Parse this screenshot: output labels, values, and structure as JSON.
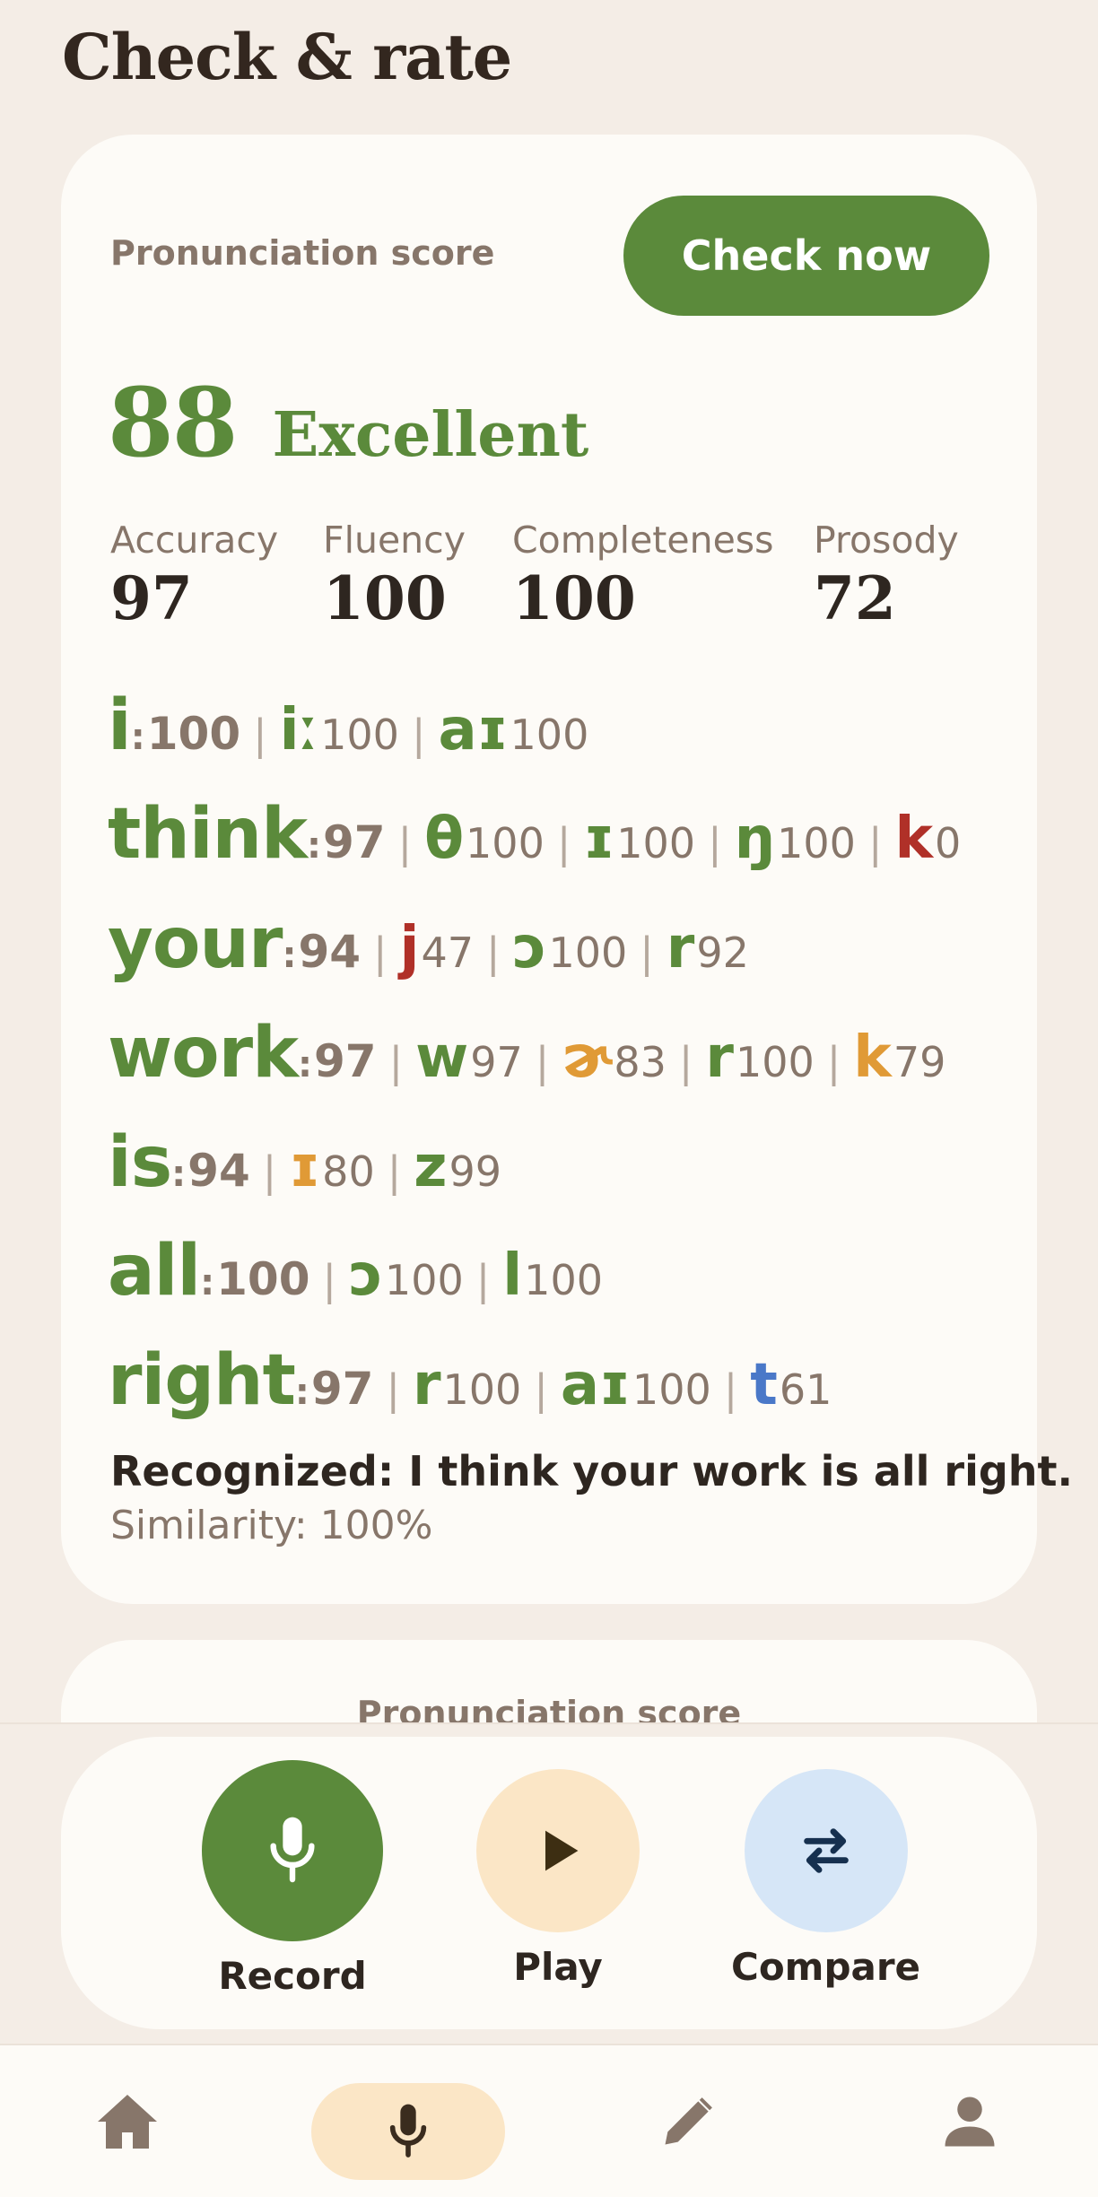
{
  "page": {
    "title": "Check & rate"
  },
  "card": {
    "label": "Pronunciation score",
    "check_button": "Check now",
    "overall_score": "88",
    "overall_label": "Excellent",
    "metrics": [
      {
        "label": "Accuracy",
        "value": "97"
      },
      {
        "label": "Fluency",
        "value": "100"
      },
      {
        "label": "Completeness",
        "value": "100"
      },
      {
        "label": "Prosody",
        "value": "72"
      }
    ],
    "words": [
      {
        "word": "i",
        "score": "100",
        "phonemes": [
          {
            "ph": "iː",
            "score": "100",
            "color": "#5b8a3b"
          },
          {
            "ph": "aɪ",
            "score": "100",
            "color": "#5b8a3b"
          }
        ]
      },
      {
        "word": "think",
        "score": "97",
        "phonemes": [
          {
            "ph": "θ",
            "score": "100",
            "color": "#5b8a3b"
          },
          {
            "ph": "ɪ",
            "score": "100",
            "color": "#5b8a3b"
          },
          {
            "ph": "ŋ",
            "score": "100",
            "color": "#5b8a3b"
          },
          {
            "ph": "k",
            "score": "0",
            "color": "#b03028"
          }
        ]
      },
      {
        "word": "your",
        "score": "94",
        "phonemes": [
          {
            "ph": "j",
            "score": "47",
            "color": "#b03028"
          },
          {
            "ph": "ɔ",
            "score": "100",
            "color": "#5b8a3b"
          },
          {
            "ph": "r",
            "score": "92",
            "color": "#5b8a3b"
          }
        ]
      },
      {
        "word": "work",
        "score": "97",
        "phonemes": [
          {
            "ph": "w",
            "score": "97",
            "color": "#5b8a3b"
          },
          {
            "ph": "ɚ",
            "score": "83",
            "color": "#e09a36"
          },
          {
            "ph": "r",
            "score": "100",
            "color": "#5b8a3b"
          },
          {
            "ph": "k",
            "score": "79",
            "color": "#e09a36"
          }
        ]
      },
      {
        "word": "is",
        "score": "94",
        "phonemes": [
          {
            "ph": "ɪ",
            "score": "80",
            "color": "#e09a36"
          },
          {
            "ph": "z",
            "score": "99",
            "color": "#5b8a3b"
          }
        ]
      },
      {
        "word": "all",
        "score": "100",
        "phonemes": [
          {
            "ph": "ɔ",
            "score": "100",
            "color": "#5b8a3b"
          },
          {
            "ph": "l",
            "score": "100",
            "color": "#5b8a3b"
          }
        ]
      },
      {
        "word": "right",
        "score": "97",
        "phonemes": [
          {
            "ph": "r",
            "score": "100",
            "color": "#5b8a3b"
          },
          {
            "ph": "aɪ",
            "score": "100",
            "color": "#5b8a3b"
          },
          {
            "ph": "t",
            "score": "61",
            "color": "#4a78c8"
          }
        ]
      }
    ],
    "recognized": "Recognized: I think your work is all right.",
    "similarity": "Similarity: 100%"
  },
  "card2": {
    "label": "Pronunciation score"
  },
  "controls": {
    "record": {
      "label": "Record",
      "icon": "mic-icon",
      "color": "#5b8a3b"
    },
    "play": {
      "label": "Play",
      "icon": "play-icon",
      "color": "#fbe6c6"
    },
    "compare": {
      "label": "Compare",
      "icon": "swap-icon",
      "color": "#d6e6f7"
    }
  },
  "nav": {
    "items": [
      {
        "icon": "home-icon"
      },
      {
        "icon": "mic-icon",
        "active": true
      },
      {
        "icon": "pencil-icon"
      },
      {
        "icon": "person-icon"
      }
    ]
  }
}
